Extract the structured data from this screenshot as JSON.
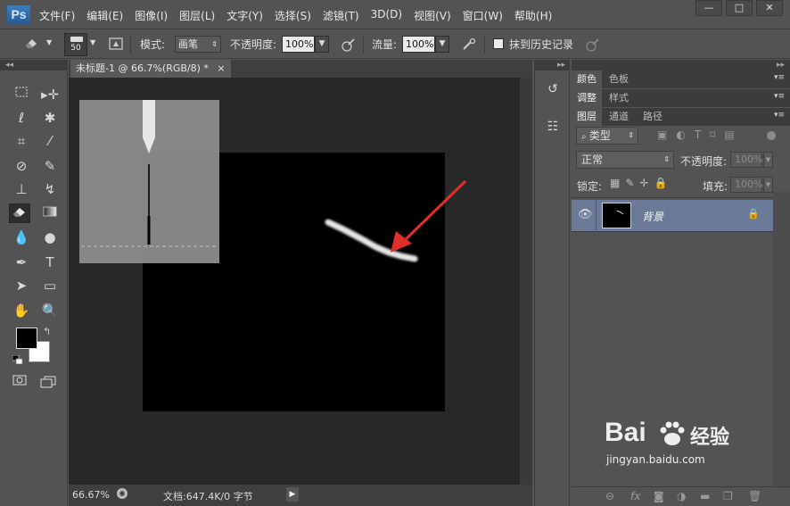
{
  "app": {
    "logo": "Ps"
  },
  "menu": [
    "文件(F)",
    "编辑(E)",
    "图像(I)",
    "图层(L)",
    "文字(Y)",
    "选择(S)",
    "滤镜(T)",
    "3D(D)",
    "视图(V)",
    "窗口(W)",
    "帮助(H)"
  ],
  "window_controls": {
    "minimize": "—",
    "maximize": "□",
    "close": "✕"
  },
  "options": {
    "brush_size": "50",
    "mode_label": "模式:",
    "mode_value": "画笔",
    "opacity_label": "不透明度:",
    "opacity_value": "100%",
    "flow_label": "流量:",
    "flow_value": "100%",
    "history_label": "抹到历史记录"
  },
  "document": {
    "tab_title": "未标题-1 @ 66.7%(RGB/8) *",
    "close": "×",
    "zoom": "66.67%",
    "doc_info": "文档:647.4K/0 字节"
  },
  "panels": {
    "row1": [
      "颜色",
      "色板"
    ],
    "row2": [
      "调整",
      "样式"
    ],
    "row3": [
      "图层",
      "通道",
      "路径"
    ],
    "filter_kind": "类型",
    "blend_mode": "正常",
    "opacity_label": "不透明度:",
    "opacity_value": "100%",
    "lock_label": "锁定:",
    "fill_label": "填充:",
    "fill_value": "100%",
    "layer_name": "背景"
  },
  "watermark": {
    "text": "Bai",
    "text2": "经验",
    "sub": "jingyan.baidu.com"
  },
  "colors": {
    "foreground": "#000000",
    "background": "#ffffff",
    "annotation_arrow": "#e0302a",
    "ui_bg": "#535353"
  },
  "icons": {
    "eraser": "eraser-icon",
    "marquee": "rectangular-marquee-icon",
    "move": "move-icon",
    "lasso": "lasso-icon",
    "magic_wand": "magic-wand-icon",
    "crop": "crop-icon",
    "eyedropper": "eyedropper-icon",
    "healing": "healing-brush-icon",
    "brush": "brush-icon",
    "stamp": "clone-stamp-icon",
    "history_brush": "history-brush-icon",
    "gradient": "gradient-icon",
    "blur": "blur-icon",
    "dodge": "dodge-icon",
    "pen": "pen-icon",
    "type": "type-icon",
    "path_select": "path-selection-icon",
    "shape": "rectangle-shape-icon",
    "hand": "hand-icon",
    "zoom": "zoom-icon",
    "eye": "eye-icon",
    "lock": "lock-icon"
  }
}
